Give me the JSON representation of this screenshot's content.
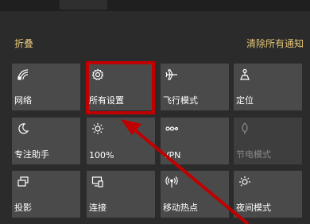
{
  "header": {
    "collapse_label": "折叠",
    "clear_all_label": "清除所有通知"
  },
  "tiles": [
    {
      "label": "网络",
      "icon": "network-icon",
      "disabled": false
    },
    {
      "label": "所有设置",
      "icon": "gear-icon",
      "disabled": false
    },
    {
      "label": "飞行模式",
      "icon": "airplane-icon",
      "disabled": false
    },
    {
      "label": "定位",
      "icon": "location-icon",
      "disabled": false
    },
    {
      "label": "专注助手",
      "icon": "moon-icon",
      "disabled": false
    },
    {
      "label": "100%",
      "icon": "brightness-icon",
      "disabled": false
    },
    {
      "label": "VPN",
      "icon": "vpn-icon",
      "disabled": false
    },
    {
      "label": "节电模式",
      "icon": "battery-saver-icon",
      "disabled": true
    },
    {
      "label": "投影",
      "icon": "project-icon",
      "disabled": false
    },
    {
      "label": "连接",
      "icon": "connect-icon",
      "disabled": false
    },
    {
      "label": "移动热点",
      "icon": "hotspot-icon",
      "disabled": false
    },
    {
      "label": "夜间模式",
      "icon": "night-light-icon",
      "disabled": false
    }
  ],
  "colors": {
    "background": "#2b2b2b",
    "tile": "#4a4a4a",
    "tile_disabled": "#3e3e3e",
    "accent_text": "#e5c57a",
    "annotation_red": "#c00000"
  }
}
